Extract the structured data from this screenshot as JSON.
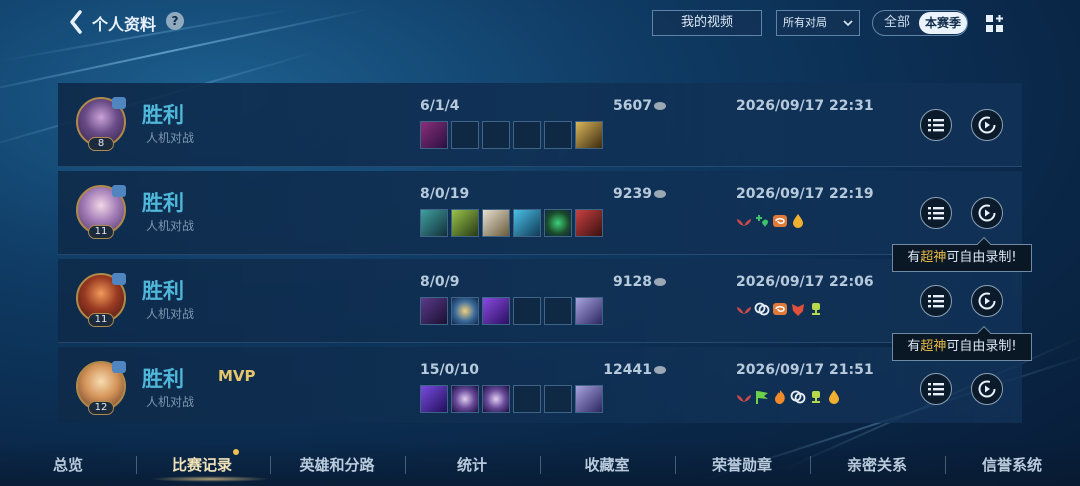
{
  "header": {
    "title": "个人资料",
    "help_icon": "?",
    "videos_button": "我的视频",
    "filter_value": "所有对局",
    "segment": {
      "all": "全部",
      "season": "本赛季",
      "selected": "本赛季"
    }
  },
  "matches": [
    {
      "result": "胜利",
      "mode": "人机对战",
      "level": "8",
      "mvp": "",
      "kda": "6/1/4",
      "gold": "5607",
      "datetime": "2026/09/17 22:31",
      "items": [
        "purple-blade",
        "empty",
        "empty",
        "empty",
        "empty",
        "gold-boots"
      ],
      "badges": []
    },
    {
      "result": "胜利",
      "mode": "人机对战",
      "level": "11",
      "mvp": "",
      "kda": "8/0/19",
      "gold": "9239",
      "datetime": "2026/09/17 22:19",
      "items": [
        "teal-staff",
        "green-helm",
        "winged-blade",
        "blue-orb",
        "green-ring",
        "red-boots"
      ],
      "badges": [
        "lotus",
        "plus-heart",
        "swirl",
        "flame-drop"
      ]
    },
    {
      "result": "胜利",
      "mode": "人机对战",
      "level": "11",
      "mvp": "",
      "kda": "8/0/9",
      "gold": "9128",
      "datetime": "2026/09/17 22:06",
      "items": [
        "dark-blade",
        "cyan-shield",
        "violet-wand",
        "empty",
        "empty",
        "purple-boots"
      ],
      "badges": [
        "lotus",
        "chain",
        "swirl",
        "crest",
        "trophy"
      ]
    },
    {
      "result": "胜利",
      "mode": "人机对战",
      "level": "12",
      "mvp": "MVP",
      "kda": "15/0/10",
      "gold": "12441",
      "datetime": "2026/09/17 21:51",
      "items": [
        "violet-gem",
        "rune-disc",
        "rune-disc",
        "empty",
        "empty",
        "purple-boots"
      ],
      "badges": [
        "lotus",
        "flag",
        "fire",
        "chain",
        "trophy",
        "flame-drop"
      ]
    }
  ],
  "tooltip": {
    "prefix": "有",
    "highlight": "超神",
    "suffix": "可自由录制!"
  },
  "tabs": [
    "总览",
    "比赛记录",
    "英雄和分路",
    "统计",
    "收藏室",
    "荣誉勋章",
    "亲密关系",
    "信誉系统"
  ],
  "active_tab": "比赛记录",
  "colors": {
    "win": "#4fb7d9",
    "mvp": "#e5c86c",
    "highlight": "#e8b83e",
    "active_tab": "#f1e3b8"
  }
}
